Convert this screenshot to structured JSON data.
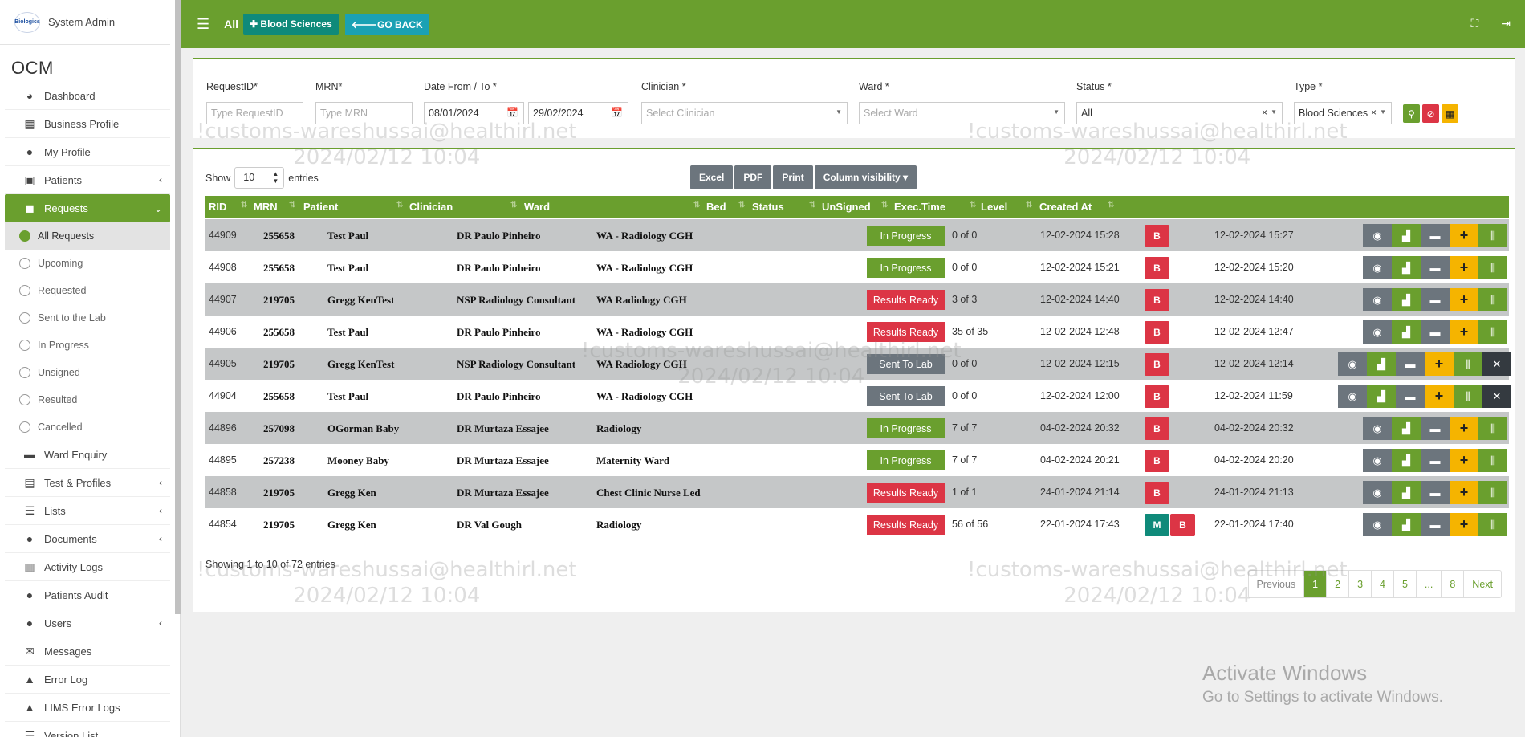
{
  "sidebar": {
    "user_name": "System Admin",
    "logo_text": "Biologics",
    "brand": "OCM",
    "items": [
      {
        "label": "Dashboard",
        "icon": "dashboard-icon"
      },
      {
        "label": "Business Profile",
        "icon": "building-icon"
      },
      {
        "label": "My Profile",
        "icon": "user-icon"
      },
      {
        "label": "Patients",
        "icon": "patients-icon"
      },
      {
        "label": "Requests",
        "icon": "requests-icon"
      },
      {
        "label": "Ward Enquiry",
        "icon": "bed-icon"
      },
      {
        "label": "Test & Profiles",
        "icon": "tests-icon"
      },
      {
        "label": "Lists",
        "icon": "list-icon"
      },
      {
        "label": "Documents",
        "icon": "documents-icon"
      },
      {
        "label": "Activity Logs",
        "icon": "activity-icon"
      },
      {
        "label": "Patients Audit",
        "icon": "audit-icon"
      },
      {
        "label": "Users",
        "icon": "users-icon"
      },
      {
        "label": "Messages",
        "icon": "messages-icon"
      },
      {
        "label": "Error Log",
        "icon": "warning-icon"
      },
      {
        "label": "LIMS Error Logs",
        "icon": "warning-icon"
      },
      {
        "label": "Version List",
        "icon": "list-icon"
      }
    ],
    "request_sub": [
      "All Requests",
      "Upcoming",
      "Requested",
      "Sent to the Lab",
      "In Progress",
      "Unsigned",
      "Resulted",
      "Cancelled"
    ]
  },
  "topbar": {
    "all_label": "All",
    "blood_sciences_label": "Blood Sciences",
    "go_back_label": "GO BACK"
  },
  "filters": {
    "request_id": {
      "label": "RequestID*",
      "placeholder": "Type RequestID"
    },
    "mrn": {
      "label": "MRN*",
      "placeholder": "Type MRN"
    },
    "date": {
      "label": "Date From / To *",
      "from": "08/01/2024",
      "to": "29/02/2024"
    },
    "clinician": {
      "label": "Clinician *",
      "placeholder": "Select Clinician"
    },
    "ward": {
      "label": "Ward *",
      "placeholder": "Select Ward"
    },
    "status": {
      "label": "Status *",
      "value": "All"
    },
    "type": {
      "label": "Type *",
      "value": "Blood Sciences"
    }
  },
  "table_controls": {
    "show_label": "Show",
    "show_value": "10",
    "entries_label": "entries",
    "buttons": [
      "Excel",
      "PDF",
      "Print",
      "Column visibility"
    ]
  },
  "columns": [
    "RID",
    "MRN",
    "Patient",
    "Clinician",
    "Ward",
    "Bed",
    "Status",
    "UnSigned",
    "Exec.Time",
    "Level",
    "Created At"
  ],
  "rows": [
    {
      "rid": "44909",
      "mrn": "255658",
      "patient": "Test Paul",
      "clinician": "DR Paulo Pinheiro",
      "ward": "WA - Radiology CGH",
      "bed": "",
      "status": "In Progress",
      "unsigned": "0 of 0",
      "exec": "12-02-2024 15:28",
      "level": [
        "B"
      ],
      "created": "12-02-2024 15:27",
      "cancel": false
    },
    {
      "rid": "44908",
      "mrn": "255658",
      "patient": "Test Paul",
      "clinician": "DR Paulo Pinheiro",
      "ward": "WA - Radiology CGH",
      "bed": "",
      "status": "In Progress",
      "unsigned": "0 of 0",
      "exec": "12-02-2024 15:21",
      "level": [
        "B"
      ],
      "created": "12-02-2024 15:20",
      "cancel": false
    },
    {
      "rid": "44907",
      "mrn": "219705",
      "patient": "Gregg KenTest",
      "clinician": "NSP Radiology Consultant",
      "ward": "WA Radiology CGH",
      "bed": "",
      "status": "Results Ready",
      "unsigned": "3 of 3",
      "exec": "12-02-2024 14:40",
      "level": [
        "B"
      ],
      "created": "12-02-2024 14:40",
      "cancel": false
    },
    {
      "rid": "44906",
      "mrn": "255658",
      "patient": "Test Paul",
      "clinician": "DR Paulo Pinheiro",
      "ward": "WA - Radiology CGH",
      "bed": "",
      "status": "Results Ready",
      "unsigned": "35 of 35",
      "exec": "12-02-2024 12:48",
      "level": [
        "B"
      ],
      "created": "12-02-2024 12:47",
      "cancel": false
    },
    {
      "rid": "44905",
      "mrn": "219705",
      "patient": "Gregg KenTest",
      "clinician": "NSP Radiology Consultant",
      "ward": "WA Radiology CGH",
      "bed": "",
      "status": "Sent To Lab",
      "unsigned": "0 of 0",
      "exec": "12-02-2024 12:15",
      "level": [
        "B"
      ],
      "created": "12-02-2024 12:14",
      "cancel": true
    },
    {
      "rid": "44904",
      "mrn": "255658",
      "patient": "Test Paul",
      "clinician": "DR Paulo Pinheiro",
      "ward": "WA - Radiology CGH",
      "bed": "",
      "status": "Sent To Lab",
      "unsigned": "0 of 0",
      "exec": "12-02-2024 12:00",
      "level": [
        "B"
      ],
      "created": "12-02-2024 11:59",
      "cancel": true
    },
    {
      "rid": "44896",
      "mrn": "257098",
      "patient": "OGorman Baby",
      "clinician": "DR Murtaza Essajee",
      "ward": "Radiology",
      "bed": "",
      "status": "In Progress",
      "unsigned": "7 of 7",
      "exec": "04-02-2024 20:32",
      "level": [
        "B"
      ],
      "created": "04-02-2024 20:32",
      "cancel": false
    },
    {
      "rid": "44895",
      "mrn": "257238",
      "patient": "Mooney Baby",
      "clinician": "DR Murtaza Essajee",
      "ward": "Maternity Ward",
      "bed": "",
      "status": "In Progress",
      "unsigned": "7 of 7",
      "exec": "04-02-2024 20:21",
      "level": [
        "B"
      ],
      "created": "04-02-2024 20:20",
      "cancel": false
    },
    {
      "rid": "44858",
      "mrn": "219705",
      "patient": "Gregg Ken",
      "clinician": "DR Murtaza Essajee",
      "ward": "Chest Clinic Nurse Led",
      "bed": "",
      "status": "Results Ready",
      "unsigned": "1 of 1",
      "exec": "24-01-2024 21:14",
      "level": [
        "B"
      ],
      "created": "24-01-2024 21:13",
      "cancel": false
    },
    {
      "rid": "44854",
      "mrn": "219705",
      "patient": "Gregg Ken",
      "clinician": "DR Val Gough",
      "ward": "Radiology",
      "bed": "",
      "status": "Results Ready",
      "unsigned": "56 of 56",
      "exec": "22-01-2024 17:43",
      "level": [
        "M",
        "B"
      ],
      "created": "22-01-2024 17:40",
      "cancel": false
    }
  ],
  "status_colors": {
    "In Progress": "#6a9f2e",
    "Results Ready": "#dc3545",
    "Sent To Lab": "#6c757d"
  },
  "level_colors": {
    "B": "#dc3545",
    "M": "#0f8a7a"
  },
  "footer": {
    "showing": "Showing 1 to 10 of 72 entries"
  },
  "pagination": [
    "Previous",
    "1",
    "2",
    "3",
    "4",
    "5",
    "...",
    "8",
    "Next"
  ],
  "watermark": {
    "line1": "!customs-wareshussai@healthirl.net",
    "line2": "2024/02/12 10:04"
  },
  "activate": {
    "title": "Activate Windows",
    "subtitle": "Go to Settings to activate Windows."
  }
}
